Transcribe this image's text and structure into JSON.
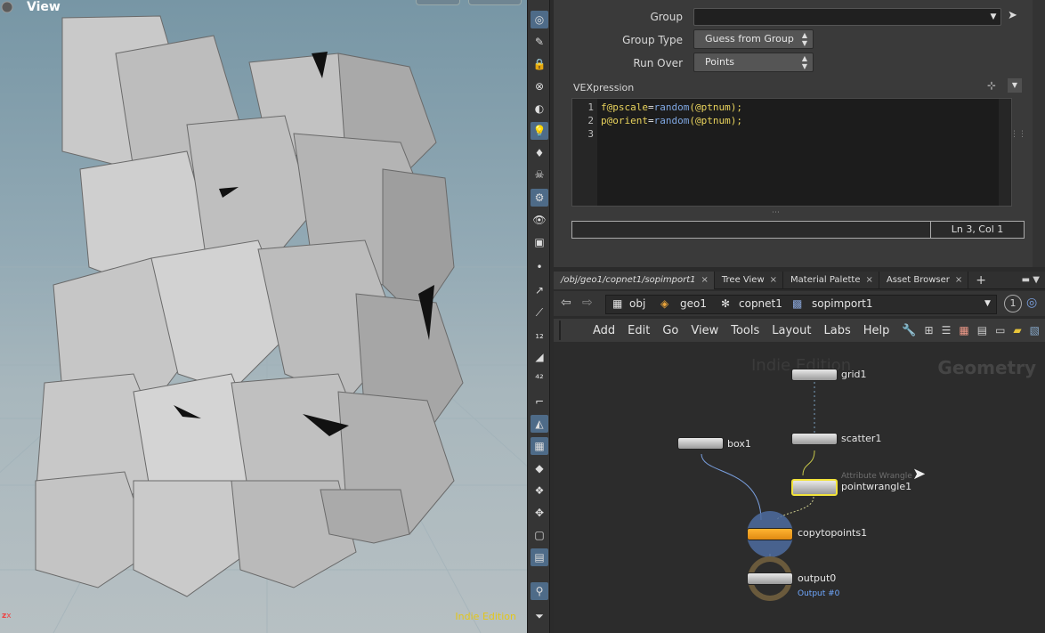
{
  "viewport": {
    "title": "View",
    "edition": "Indie Edition"
  },
  "params": {
    "group_label": "Group",
    "group_value": "",
    "group_type_label": "Group Type",
    "group_type_value": "Guess from Group",
    "run_over_label": "Run Over",
    "run_over_value": "Points",
    "vex_label": "VEXpression",
    "code_lines": [
      "1",
      "2",
      "3"
    ],
    "line1_var": "f@pscale",
    "line1_eq": "=",
    "line1_fn": "random",
    "line1_arg": "(@ptnum);",
    "line2_var": "p@orient",
    "line2_eq": "=",
    "line2_fn": "random",
    "line2_arg": "(@ptnum);",
    "status_pos": "Ln 3, Col 1"
  },
  "tabs": [
    {
      "label": "/obj/geo1/copnet1/sopimport1"
    },
    {
      "label": "Tree View"
    },
    {
      "label": "Material Palette"
    },
    {
      "label": "Asset Browser"
    }
  ],
  "path": {
    "obj": "obj",
    "geo": "geo1",
    "copnet": "copnet1",
    "sop": "sopimport1",
    "badge": "1"
  },
  "menu": [
    "Add",
    "Edit",
    "Go",
    "View",
    "Tools",
    "Layout",
    "Labs",
    "Help"
  ],
  "network": {
    "watermark": "Indie Edition",
    "context": "Geometry",
    "nodes": {
      "grid": "grid1",
      "scatter": "scatter1",
      "box": "box1",
      "wrangle_type": "Attribute Wrangle",
      "wrangle": "pointwrangle1",
      "copy": "copytopoints1",
      "output": "output0",
      "output_sub": "Output #0"
    }
  }
}
